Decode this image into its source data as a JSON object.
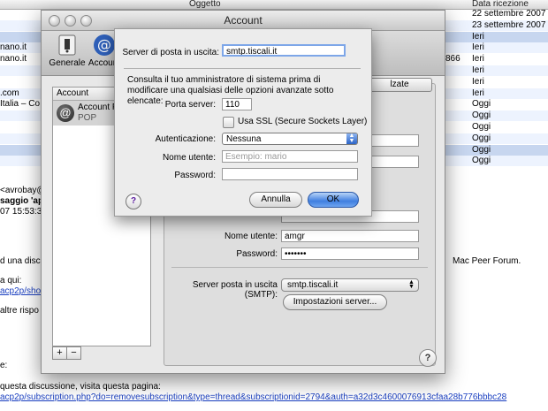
{
  "mail": {
    "headers": {
      "subject": "Oggetto",
      "date": "Data ricezione"
    },
    "rows": [
      {
        "left": "",
        "mid": "",
        "date": "22 settembre 2007"
      },
      {
        "left": "",
        "mid": "",
        "date": "23 settembre 2007"
      },
      {
        "left": "",
        "mid": "",
        "date": "Ieri"
      },
      {
        "left": "nano.it",
        "mid": "",
        "date": "Ieri"
      },
      {
        "left": "nano.it",
        "mid": "866",
        "date": "Ieri"
      },
      {
        "left": "",
        "mid": "",
        "date": "Ieri"
      },
      {
        "left": "",
        "mid": "",
        "date": "Ieri"
      },
      {
        "left": ".com",
        "mid": "",
        "date": "Ieri"
      },
      {
        "left": "Italia – Co",
        "mid": "",
        "date": "Oggi"
      },
      {
        "left": "",
        "mid": "",
        "date": "Oggi"
      },
      {
        "left": "",
        "mid": "",
        "date": "Oggi"
      },
      {
        "left": "",
        "mid": "",
        "date": "Oggi"
      },
      {
        "left": "",
        "mid": "",
        "date": "Oggi"
      },
      {
        "left": "",
        "mid": "",
        "date": "Oggi"
      }
    ],
    "preview": {
      "from": "<avrobay@",
      "subject": "saggio 'app",
      "date": "07 15:53:32",
      "line1": "d una discu",
      "line1_right": "Mac Peer Forum.",
      "line2": "a qui:",
      "link1": "acp2p/show",
      "line3": "altre rispo",
      "line4": "e:",
      "line5": "questa discussione, visita questa pagina:",
      "link2": "acp2p/subscription.php?do=removesubscription&type=thread&subscriptionid=2794&auth=a32d3c4600076913cfaa28b776bbbc28"
    }
  },
  "prefs": {
    "title": "Account",
    "toolbar": {
      "general": "Generale",
      "accounts": "Account"
    },
    "list_header": "Account",
    "account": {
      "name": "Account P",
      "type": "POP"
    },
    "advanced_tab": "lzate",
    "user_label": "Nome utente:",
    "user_value": "amgr",
    "password_label": "Password:",
    "password_value": "•••••••",
    "smtp_label": "Server posta in uscita (SMTP):",
    "smtp_value": "smtp.tiscali.it",
    "smtp_settings_button": "Impostazioni server...",
    "add": "+",
    "remove": "−",
    "help": "?"
  },
  "sheet": {
    "server_label": "Server di posta in uscita:",
    "server_value": "smtp.tiscali.it",
    "note": "Consulta il tuo amministratore di sistema prima di modificare una qualsiasi delle opzioni avanzate sotto elencate:",
    "port_label": "Porta server:",
    "port_value": "110",
    "ssl_label": "Usa SSL (Secure Sockets Layer)",
    "auth_label": "Autenticazione:",
    "auth_value": "Nessuna",
    "user_label": "Nome utente:",
    "user_placeholder": "Esempio: mario",
    "password_label": "Password:",
    "cancel": "Annulla",
    "ok": "OK",
    "help": "?"
  }
}
